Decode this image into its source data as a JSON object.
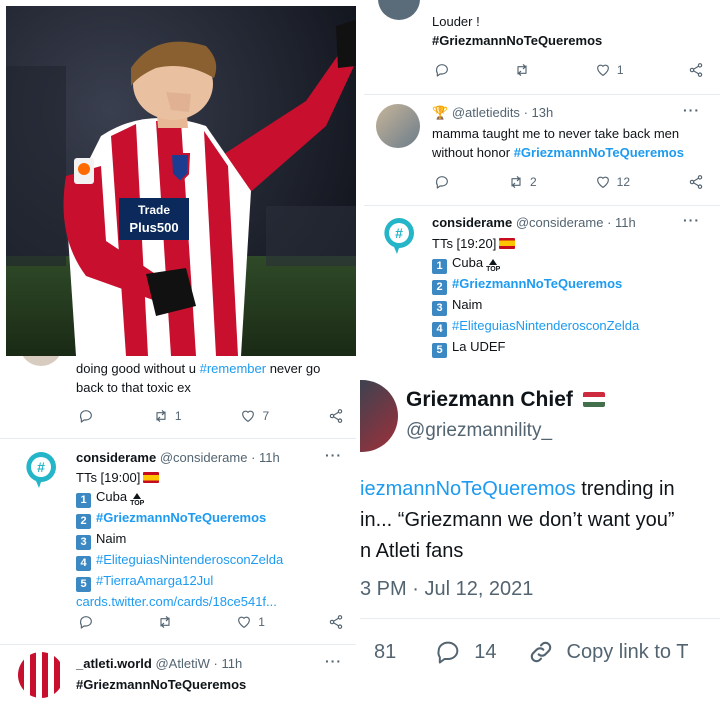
{
  "colors": {
    "link": "#1d9bf0",
    "muted": "#536471",
    "rank_badge": "#3b88c3"
  },
  "photo": {
    "jersey_text_1": "Trade",
    "jersey_text_2": "Plus500"
  },
  "top_right_tweet": {
    "text": "Louder !",
    "hashtag": "#GriezmannNoTeQueremos",
    "replies": "",
    "retweets": "",
    "likes": "1"
  },
  "atletiedits_tweet": {
    "prefix_icon": "trophy-icon",
    "handle": "@atletiedits",
    "time": "13h",
    "text": "mamma taught me to never take back men without honor",
    "hashtag": "#GriezmannNoTeQueremos",
    "retweets": "2",
    "likes": "12"
  },
  "considerame_right": {
    "name": "considerame",
    "handle": "@considerame",
    "time": "11h",
    "header": "TTs [19:20]",
    "items": [
      {
        "rank": "1",
        "text": "Cuba",
        "is_hashtag": false,
        "badge": "TOP"
      },
      {
        "rank": "2",
        "text": "#GriezmannNoTeQueremos",
        "is_hashtag": true
      },
      {
        "rank": "3",
        "text": "Naim",
        "is_hashtag": false
      },
      {
        "rank": "4",
        "text": "#EliteguiasNintenderosconZelda",
        "is_hashtag": true
      },
      {
        "rank": "5",
        "text": "La UDEF",
        "is_hashtag": false
      }
    ]
  },
  "left_partial_tweet": {
    "text_before": "doing good without u",
    "hashtag": "#remember",
    "text_after": "never go back to that toxic ex",
    "retweets": "1",
    "likes": "7"
  },
  "considerame_left": {
    "name": "considerame",
    "handle": "@considerame",
    "time": "11h",
    "header": "TTs [19:00]",
    "items": [
      {
        "rank": "1",
        "text": "Cuba",
        "is_hashtag": false,
        "badge": "TOP"
      },
      {
        "rank": "2",
        "text": "#GriezmannNoTeQueremos",
        "is_hashtag": true
      },
      {
        "rank": "3",
        "text": "Naim",
        "is_hashtag": false
      },
      {
        "rank": "4",
        "text": "#EliteguiasNintenderosconZelda",
        "is_hashtag": true
      },
      {
        "rank": "5",
        "text": "#TierraAmarga12Jul",
        "is_hashtag": true
      }
    ],
    "link": "cards.twitter.com/cards/18ce541f...",
    "retweets": "",
    "likes": "1"
  },
  "atleti_world_tweet": {
    "name": "_atleti.world",
    "handle": "@AtletiW",
    "time": "11h",
    "hashtag": "#GriezmannNoTeQueremos"
  },
  "zoomed_tweet": {
    "name": "Griezmann Chief",
    "handle": "@griezmannility_",
    "line1_hashtag": "iezmannNoTeQueremos",
    "line1_rest": "trending in",
    "line2": "in... “Griezmann we don’t want you”",
    "line3": "n Atleti fans",
    "timestamp": "3 PM · Jul 12, 2021",
    "retweets": "81",
    "replies": "14",
    "copy_link": "Copy link to T"
  }
}
